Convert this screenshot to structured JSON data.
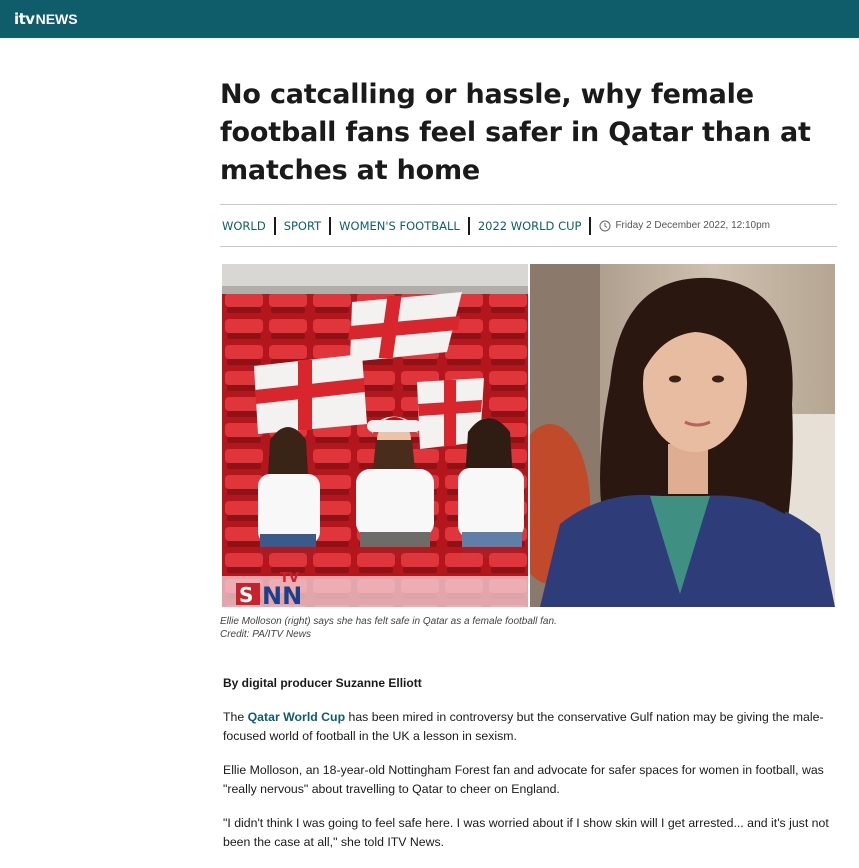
{
  "brand": {
    "logo_itv": "itv",
    "logo_news": "NEWS"
  },
  "article": {
    "headline": "No catcalling or hassle, why female football fans feel safer in Qatar than at matches at home",
    "tags": [
      "WORLD",
      "SPORT",
      "WOMEN'S FOOTBALL",
      "2022 WORLD CUP"
    ],
    "date": "Friday 2 December 2022, 12:10pm",
    "caption_line1": "Ellie Molloson (right) says she has felt safe in Qatar as a female football fan.",
    "caption_line2": "Credit: PA/ITV News",
    "watermark": "SNN TV",
    "byline": "By digital producer Suzanne Elliott",
    "p1_before": "The ",
    "p1_link": "Qatar World Cup",
    "p1_after": " has been mired in controversy but the conservative Gulf nation may be giving the male-focused world of football in the UK a lesson in sexism.",
    "p2": "Ellie Molloson, an 18-year-old Nottingham Forest fan and advocate for safer spaces for women in football, was \"really nervous\" about travelling to Qatar to cheer on England.",
    "p3": "\"I didn't think I was going to feel safe here. I was worried about if I show skin will I get arrested... and it's just not been the case at all,\" she told ITV News."
  },
  "icons": {
    "clock": "clock-icon"
  },
  "colors": {
    "brand_teal": "#0f5d6a",
    "seat_red": "#d9262c",
    "text": "#1a1a1a"
  }
}
